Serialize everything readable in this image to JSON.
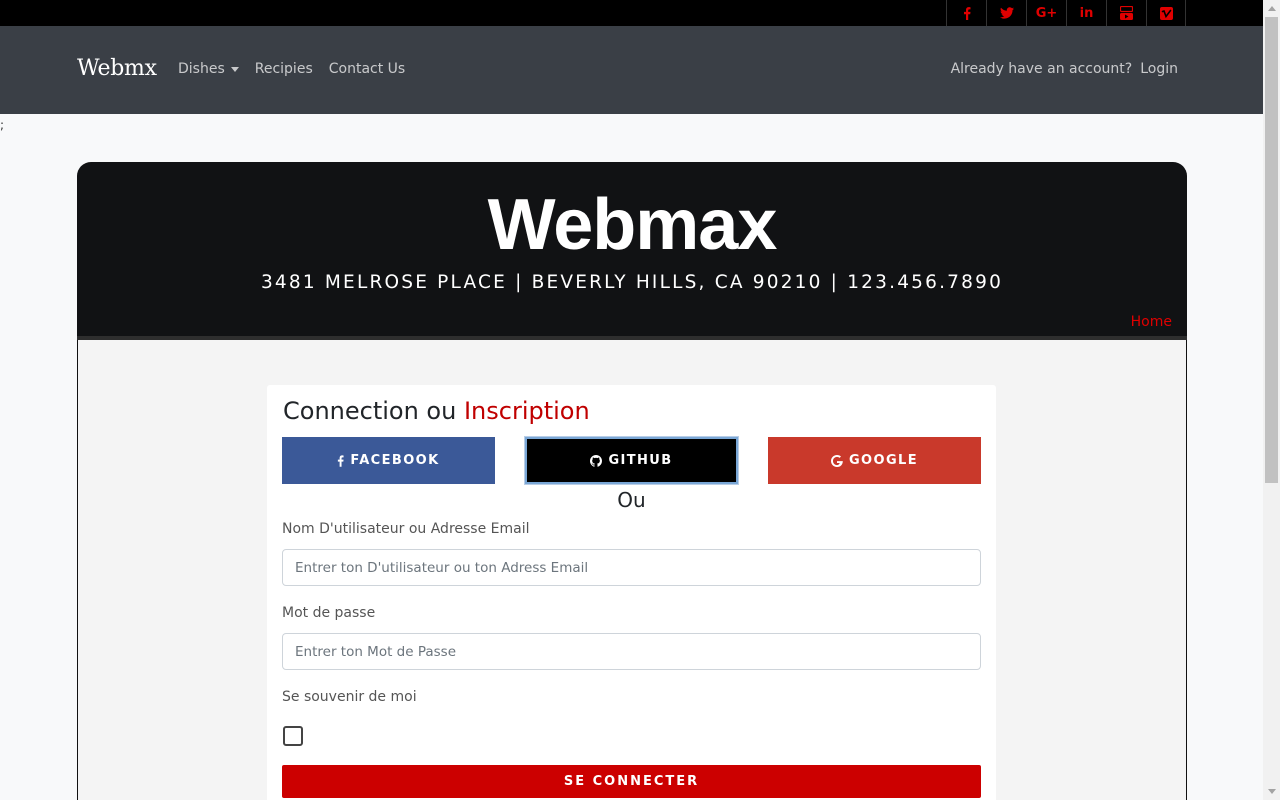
{
  "social_icons": [
    {
      "name": "facebook-icon",
      "glyph": "f"
    },
    {
      "name": "twitter-icon",
      "glyph": ""
    },
    {
      "name": "google-plus-icon",
      "glyph": "G+"
    },
    {
      "name": "linkedin-icon",
      "glyph": "in"
    },
    {
      "name": "youtube-icon",
      "glyph": ""
    },
    {
      "name": "vimeo-icon",
      "glyph": ""
    }
  ],
  "navbar": {
    "brand": "Webmx",
    "links": {
      "dishes": "Dishes",
      "recipes": "Recipies",
      "contact": "Contact Us"
    },
    "account_prompt": "Already have an account?",
    "login": "Login"
  },
  "stray_text": ";",
  "hero": {
    "title": "Webmax",
    "subtitle": "3481 MELROSE PLACE | BEVERLY HILLS, CA 90210 | 123.456.7890",
    "home_link": "Home"
  },
  "login_form": {
    "title_part1": "Connection ou",
    "title_part2": "Inscription",
    "social_buttons": {
      "facebook": "FACEBOOK",
      "github": "GITHUB",
      "google": "GOOGLE"
    },
    "divider": "Ou",
    "username_label": "Nom D'utilisateur ou Adresse Email",
    "username_placeholder": "Entrer ton D'utilisateur ou ton Adress Email",
    "password_label": "Mot de passe",
    "password_placeholder": "Entrer ton Mot de Passe",
    "remember_label": "Se souvenir de moi",
    "remember_checked": false,
    "submit": "SE CONNECTER"
  },
  "colors": {
    "accent_red": "#cc0000",
    "facebook_blue": "#3b5998",
    "google_red": "#c9392b",
    "navbar_bg": "#3a3f46"
  }
}
